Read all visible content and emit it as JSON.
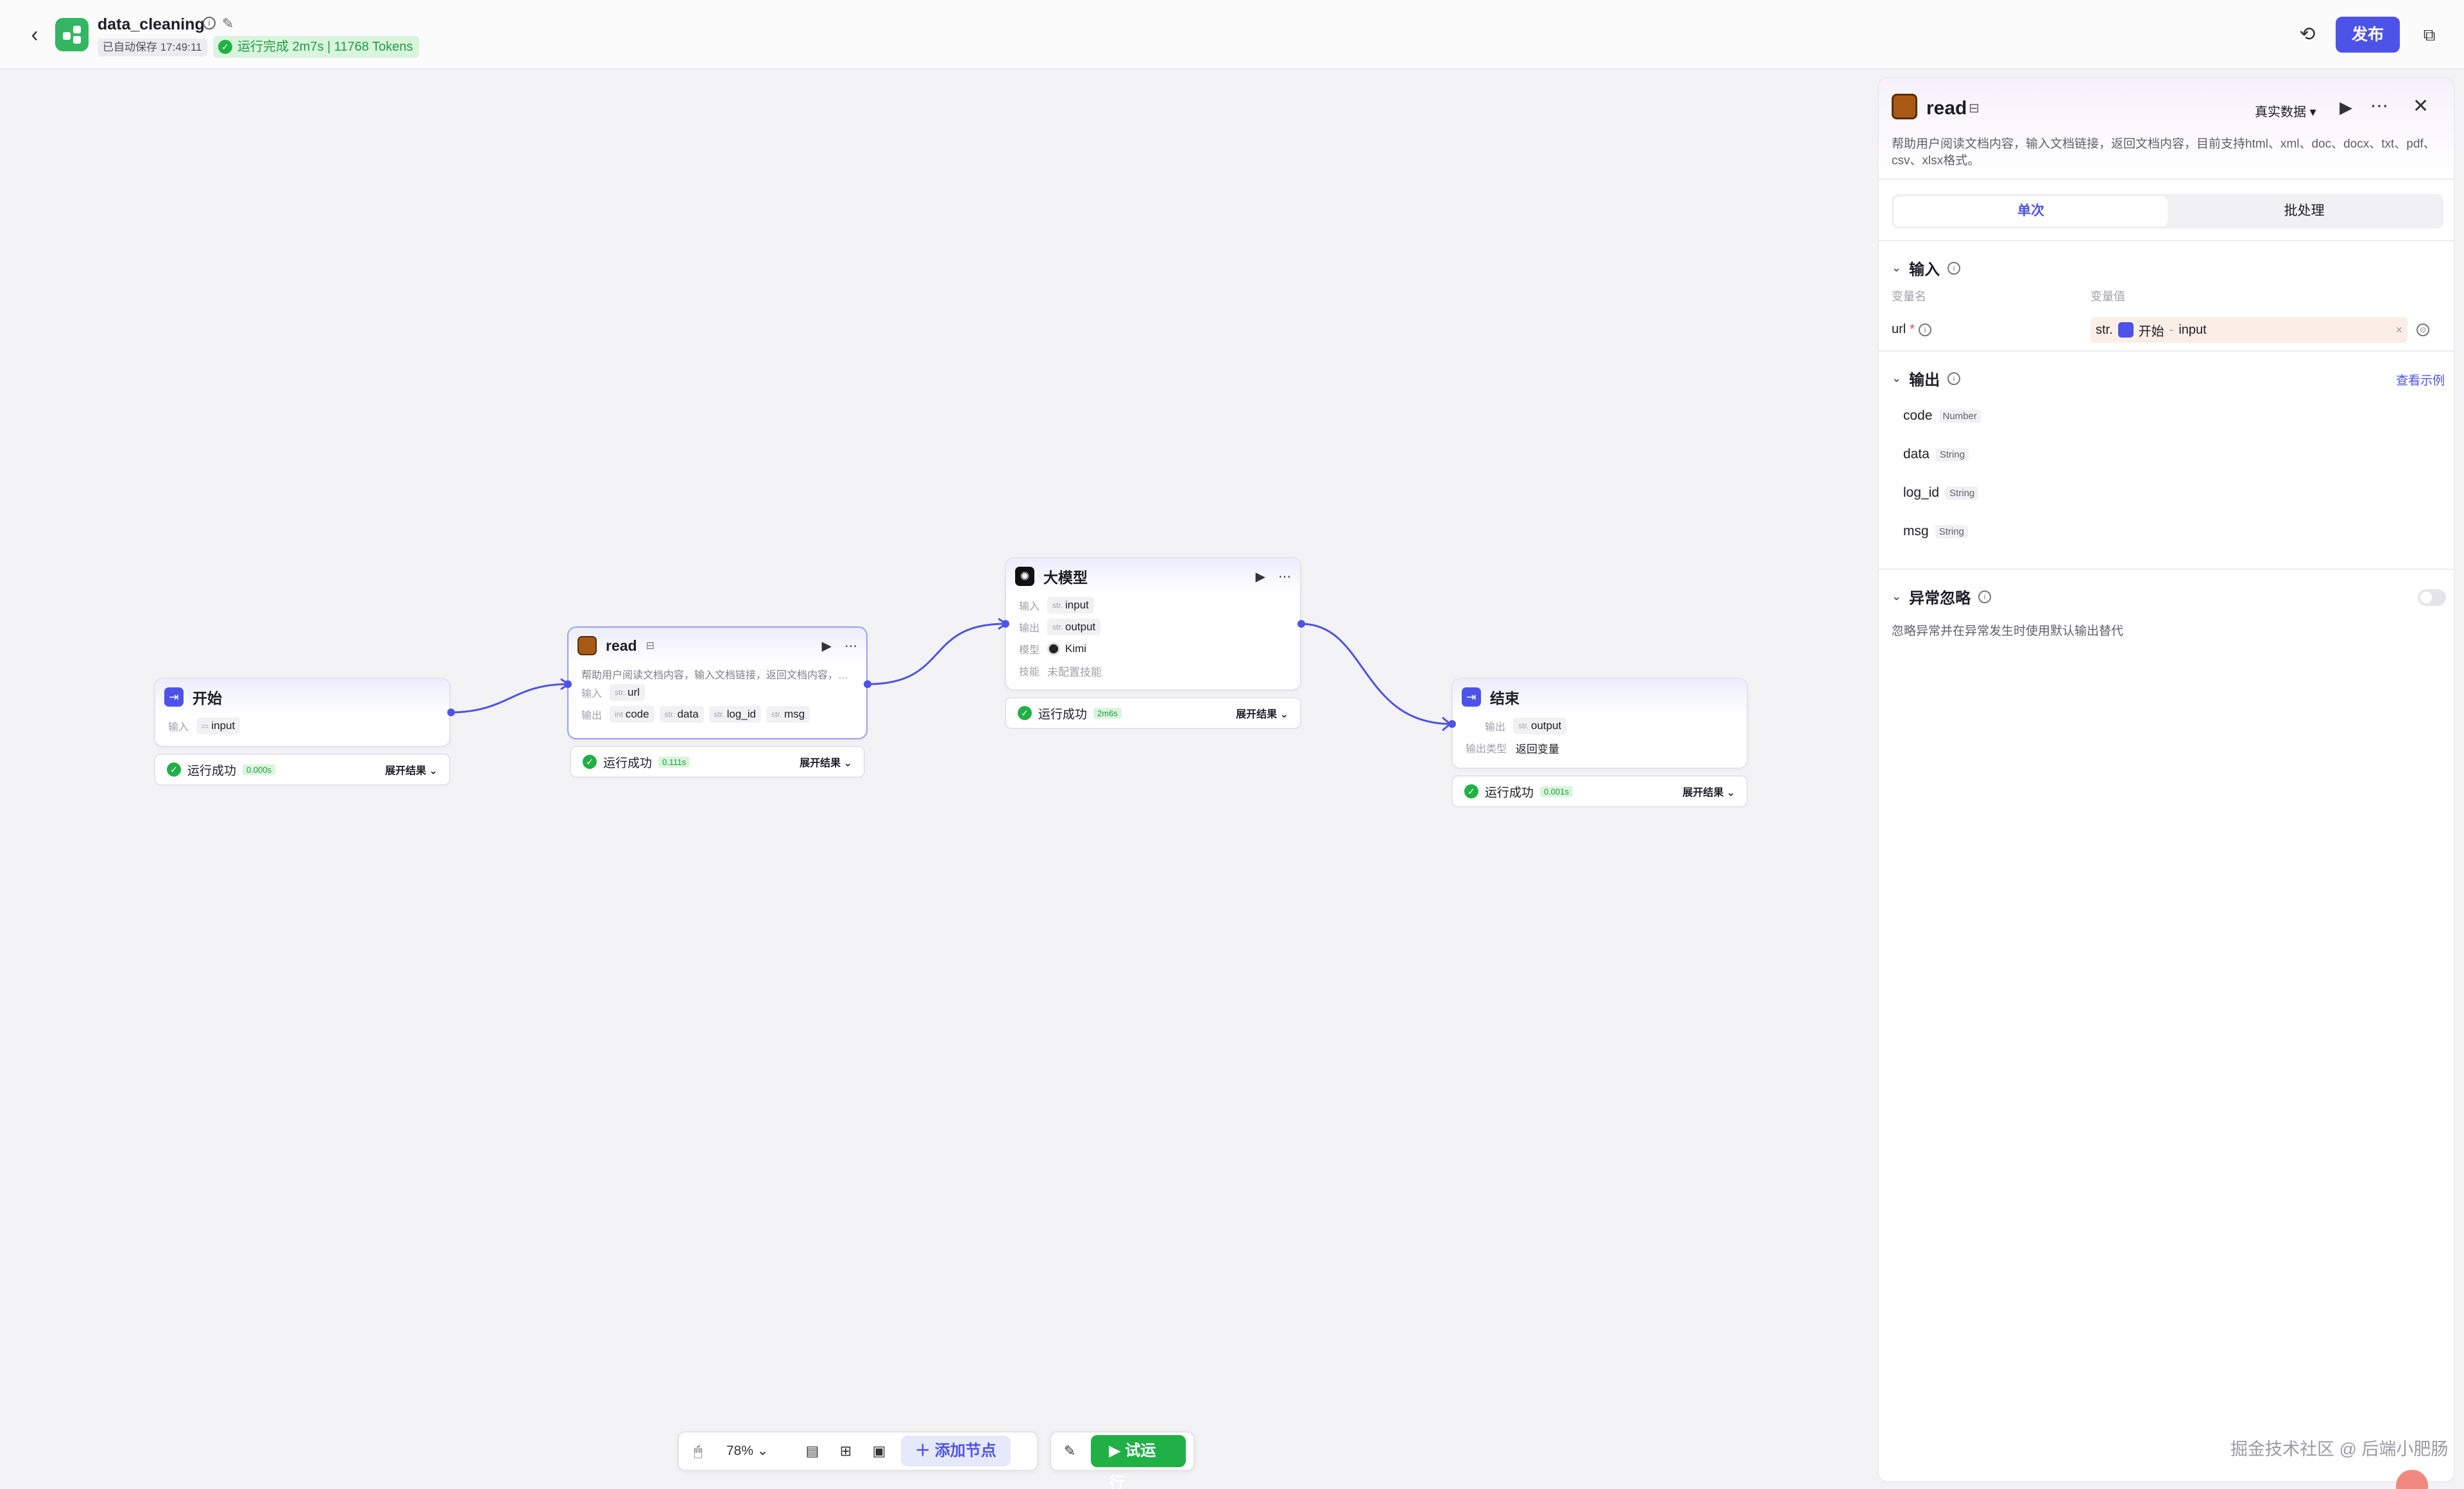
{
  "header": {
    "back": "‹",
    "title": "data_cleaning",
    "autosave": "已自动保存 17:49:11",
    "run_status": "运行完成 2m7s | 11768 Tokens",
    "publish": "发布"
  },
  "canvas": {
    "nodes": {
      "start": {
        "title": "开始",
        "input_label": "输入",
        "input_tag": "input",
        "run_text": "运行成功",
        "time": "0.000s",
        "expand": "展开结果"
      },
      "read": {
        "title": "read",
        "desc": "帮助用户阅读文档内容，输入文档链接，返回文档内容，目前…",
        "input_label": "输入",
        "input_type": "str.",
        "input_var": "url",
        "output_label": "输出",
        "outputs": [
          {
            "type": "int",
            "name": "code"
          },
          {
            "type": "str.",
            "name": "data"
          },
          {
            "type": "str.",
            "name": "log_id"
          },
          {
            "type": "str.",
            "name": "msg"
          }
        ],
        "run_text": "运行成功",
        "time": "0.111s",
        "expand": "展开结果"
      },
      "llm": {
        "title": "大模型",
        "input_label": "输入",
        "input_type": "str.",
        "input_var": "input",
        "output_label": "输出",
        "output_type": "str.",
        "output_var": "output",
        "model_label": "模型",
        "model": "Kimi",
        "skill_label": "技能",
        "skill": "未配置技能",
        "run_text": "运行成功",
        "time": "2m6s",
        "expand": "展开结果"
      },
      "end": {
        "title": "结束",
        "output_label": "输出",
        "output_type": "str.",
        "output_var": "output",
        "mode_label": "输出类型",
        "mode": "返回变量",
        "run_text": "运行成功",
        "time": "0.001s",
        "expand": "展开结果"
      }
    }
  },
  "toolbar": {
    "zoom": "78%",
    "add_node": "添加节点",
    "trial_run": "试运行"
  },
  "panel": {
    "title": "read",
    "data_mode": "真实数据 ▾",
    "description": "帮助用户阅读文档内容，输入文档链接，返回文档内容，目前支持html、xml、doc、docx、txt、pdf、csv、xlsx格式。",
    "tabs": [
      "单次",
      "批处理"
    ],
    "input": {
      "title": "输入",
      "col_name": "变量名",
      "col_value": "变量值",
      "var_name": "url",
      "required": "*",
      "value_type": "str.",
      "value_node": "开始",
      "value_sep": "-",
      "value_var": "input",
      "clear": "×"
    },
    "output": {
      "title": "输出",
      "example_link": "查看示例",
      "items": [
        {
          "name": "code",
          "type": "Number"
        },
        {
          "name": "data",
          "type": "String"
        },
        {
          "name": "log_id",
          "type": "String"
        },
        {
          "name": "msg",
          "type": "String"
        }
      ]
    },
    "exception": {
      "title": "异常忽略",
      "desc": "忽略异常并在异常发生时使用默认输出替代"
    }
  },
  "watermark": "掘金技术社区 @ 后端小肥肠",
  "colors": {
    "accent": "#4d53e8",
    "success": "#21b046",
    "canvas_bg": "#f3f3f5"
  }
}
